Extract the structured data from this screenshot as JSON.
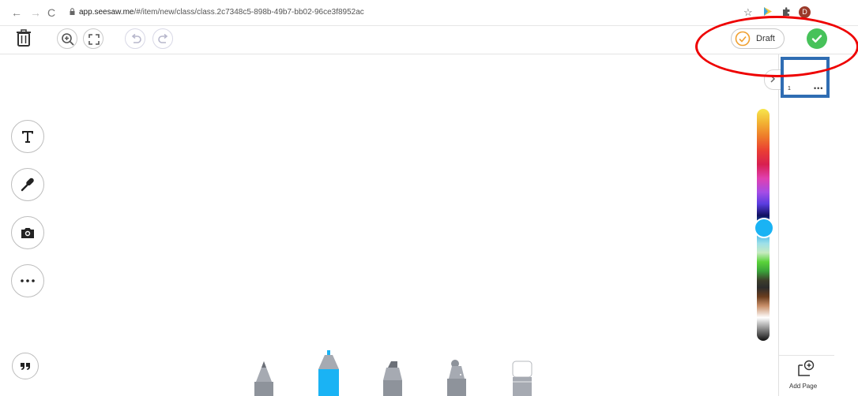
{
  "browser": {
    "url_host": "app.seesaw.me",
    "url_path": "/#/item/new/class/class.2c7348c5-898b-49b7-bb02-96ce3f8952ac",
    "avatar_letter": "D"
  },
  "toolbar": {
    "draft_label": "Draft"
  },
  "pages": {
    "items": [
      {
        "number": "1",
        "menu": "•••"
      }
    ],
    "add_page_label": "Add Page"
  },
  "tools": [
    "text",
    "microphone",
    "camera",
    "more",
    "quote"
  ],
  "pens": [
    "pencil",
    "marker",
    "highlighter",
    "spray",
    "eraser"
  ],
  "colors": {
    "selected": "#1ab3f4",
    "accent_check": "#47c25a",
    "annotation_red": "#e00000",
    "annotation_blue": "#2f6db3",
    "draft_orange": "#f0a030"
  }
}
